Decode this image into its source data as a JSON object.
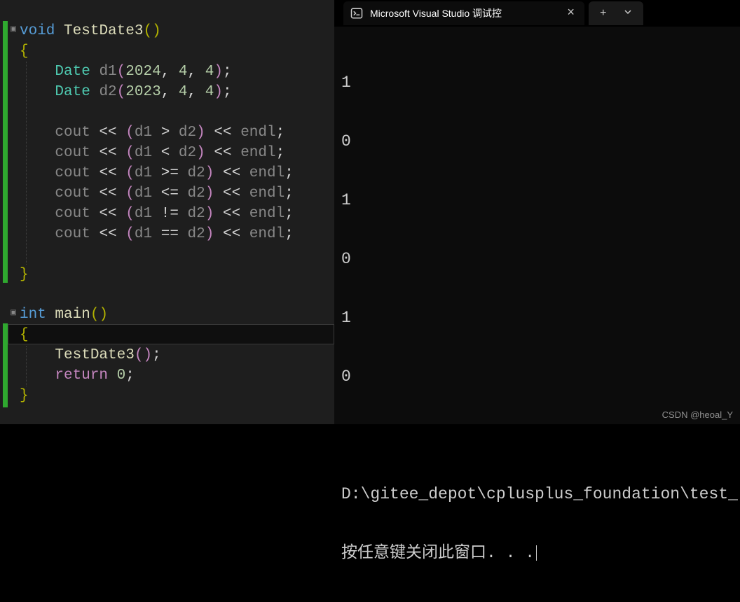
{
  "editor": {
    "func_sig": {
      "kw": "void",
      "name": "TestDate3",
      "lparen": "(",
      "rparen": ")"
    },
    "open_brace": "{",
    "d1": {
      "type": "Date",
      "name": "d1",
      "lparen": "(",
      "a1": "2024",
      "c1": ",",
      "a2": "4",
      "c2": ",",
      "a3": "4",
      "rparen": ")",
      "semi": ";"
    },
    "d2": {
      "type": "Date",
      "name": "d2",
      "lparen": "(",
      "a1": "2023",
      "c1": ",",
      "a2": "4",
      "c2": ",",
      "a3": "4",
      "rparen": ")",
      "semi": ";"
    },
    "out": [
      {
        "cout": "cout",
        "ls": "<<",
        "lp": "(",
        "v1": "d1",
        "op": " > ",
        "v2": "d2",
        "rp": ")",
        "ls2": "<<",
        "end": "endl",
        "semi": ";"
      },
      {
        "cout": "cout",
        "ls": "<<",
        "lp": "(",
        "v1": "d1",
        "op": " < ",
        "v2": "d2",
        "rp": ")",
        "ls2": "<<",
        "end": "endl",
        "semi": ";"
      },
      {
        "cout": "cout",
        "ls": "<<",
        "lp": "(",
        "v1": "d1",
        "op": " >= ",
        "v2": "d2",
        "rp": ")",
        "ls2": "<<",
        "end": "endl",
        "semi": ";"
      },
      {
        "cout": "cout",
        "ls": "<<",
        "lp": "(",
        "v1": "d1",
        "op": " <= ",
        "v2": "d2",
        "rp": ")",
        "ls2": "<<",
        "end": "endl",
        "semi": ";"
      },
      {
        "cout": "cout",
        "ls": "<<",
        "lp": "(",
        "v1": "d1",
        "op": " != ",
        "v2": "d2",
        "rp": ")",
        "ls2": "<<",
        "end": "endl",
        "semi": ";"
      },
      {
        "cout": "cout",
        "ls": "<<",
        "lp": "(",
        "v1": "d1",
        "op": " == ",
        "v2": "d2",
        "rp": ")",
        "ls2": "<<",
        "end": "endl",
        "semi": ";"
      }
    ],
    "close_brace": "}",
    "main_sig": {
      "kw": "int",
      "name": "main",
      "lparen": "(",
      "rparen": ")"
    },
    "main_open": "{",
    "call": {
      "name": "TestDate3",
      "lparen": "(",
      "rparen": ")",
      "semi": ";"
    },
    "ret": {
      "kw": "return",
      "val": "0",
      "semi": ";"
    },
    "main_close": "}"
  },
  "terminal": {
    "tab_title": "Microsoft Visual Studio 调试控",
    "output": [
      "1",
      "0",
      "1",
      "0",
      "1",
      "0"
    ],
    "path_line": "D:\\gitee_depot\\cplusplus_foundation\\test_",
    "prompt_line": "按任意键关闭此窗口. . .",
    "new_tab": "+",
    "dropdown": "⌄",
    "close": "×"
  },
  "watermark": "CSDN @heoal_Y"
}
